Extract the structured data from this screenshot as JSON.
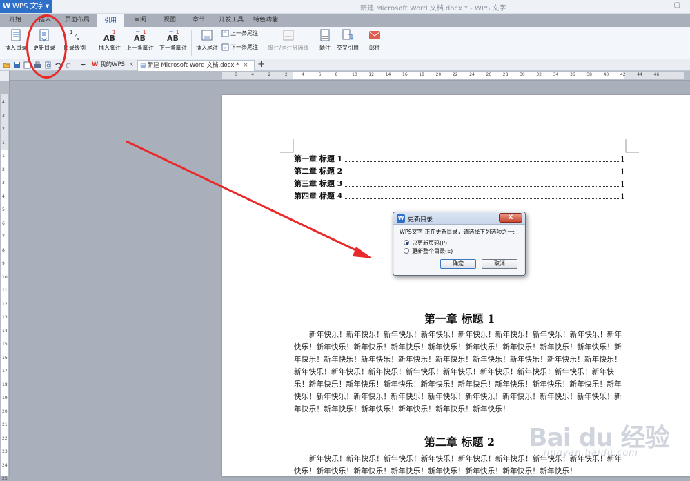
{
  "app": {
    "menu_label": "WPS 文字",
    "window_title": "新建 Microsoft Word 文档.docx * - WPS 文字"
  },
  "menu_tabs": [
    "开始",
    "插入",
    "页面布局",
    "引用",
    "审阅",
    "视图",
    "章节",
    "开发工具",
    "特色功能"
  ],
  "ribbon": {
    "insert_toc": "插入目录",
    "update_toc": "更新目录",
    "toc_level": "目录级别",
    "insert_footnote": "插入脚注",
    "prev_footnote": "上一条脚注",
    "next_footnote": "下一条脚注",
    "insert_endnote": "插入尾注",
    "prev_endnote": "上一条尾注",
    "next_endnote": "下一条尾注",
    "separator": "脚注/尾注分隔线",
    "caption": "题注",
    "cross_ref": "交叉引用",
    "mail": "邮件"
  },
  "doc_tabs": [
    {
      "label": "我的WPS",
      "close": "×"
    },
    {
      "label": "新建 Microsoft Word 文档.docx *",
      "close": "×"
    }
  ],
  "new_tab": "+",
  "ruler": {
    "h_ticks": [
      "6",
      "4",
      "2",
      "2",
      "4",
      "6",
      "8",
      "10",
      "12",
      "14",
      "16",
      "18",
      "20",
      "22",
      "24",
      "26",
      "28",
      "30",
      "32",
      "34",
      "36",
      "38",
      "40",
      "42",
      "44",
      "46"
    ],
    "v_ticks": [
      "4",
      "3",
      "2",
      "1",
      "1",
      "2",
      "3",
      "4",
      "5",
      "6",
      "7",
      "8",
      "9",
      "10",
      "11",
      "12",
      "13",
      "14",
      "15",
      "16",
      "17",
      "18",
      "19",
      "20",
      "21",
      "22",
      "23",
      "24",
      "25"
    ]
  },
  "toc": [
    {
      "title": "第一章  标题 1",
      "page": "1"
    },
    {
      "title": "第二章  标题 2",
      "page": "1"
    },
    {
      "title": "第三章  标题 3",
      "page": "1"
    },
    {
      "title": "第四章  标题 4",
      "page": "1"
    }
  ],
  "sections": [
    {
      "heading": "第一章  标题 1",
      "body": "新年快乐！新年快乐！新年快乐！新年快乐！新年快乐！新年快乐！新年快乐！新年快乐！新年快乐！新年快乐！新年快乐！新年快乐！新年快乐！新年快乐！新年快乐！新年快乐！新年快乐！新年快乐！新年快乐！新年快乐！新年快乐！新年快乐！新年快乐！新年快乐！新年快乐！新年快乐！新年快乐！新年快乐！新年快乐！新年快乐！新年快乐！新年快乐！新年快乐！新年快乐！新年快乐！新年快乐！新年快乐！新年快乐！新年快乐！新年快乐！新年快乐！新年快乐！新年快乐！新年快乐！新年快乐！新年快乐！新年快乐！新年快乐！新年快乐！新年快乐！新年快乐！新年快乐！新年快乐！新年快乐！新年快乐！新年快乐！新年快乐！新年快乐！"
    },
    {
      "heading": "第二章  标题 2",
      "body": "新年快乐！新年快乐！新年快乐！新年快乐！新年快乐！新年快乐！新年快乐！新年快乐！新年快乐！新年快乐！新年快乐！新年快乐！新年快乐！新年快乐！新年快乐！新年快乐！"
    }
  ],
  "dialog": {
    "title": "更新目录",
    "close": "X",
    "message": "WPS文字 正在更新目录，请选择下列选项之一:",
    "option_pages": "只更新页码(P)",
    "option_all": "更新整个目录(E)",
    "selected": "option_pages",
    "ok": "确定",
    "cancel": "取消"
  },
  "watermark": {
    "brand": "Bai du 经验",
    "url": "jingyan.baidu.com"
  },
  "colors": {
    "accent": "#2e6fc7",
    "annotation_red": "#e82a2a"
  }
}
